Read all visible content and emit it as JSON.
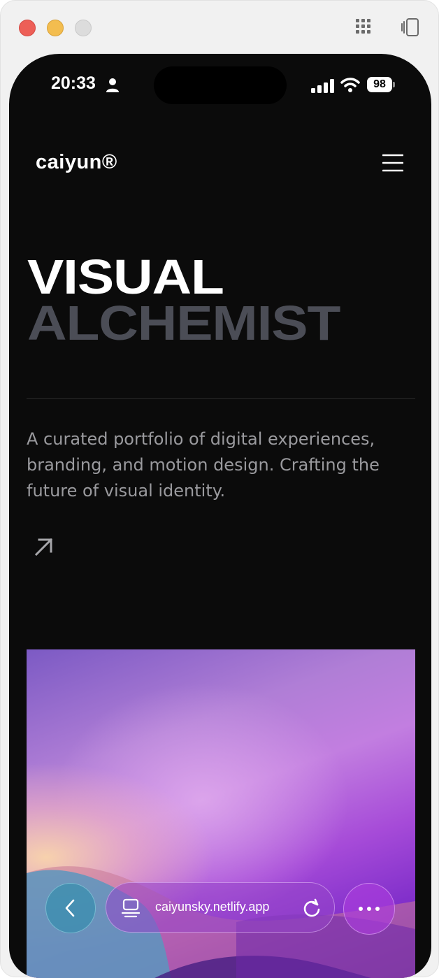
{
  "status_bar": {
    "time": "20:33",
    "battery": "98"
  },
  "site": {
    "logo": "caiyun®",
    "hero_line1": "VISUAL",
    "hero_line2": "ALCHEMIST",
    "description": "A curated portfolio of digital experiences, branding, and motion design. Crafting the future of visual identity."
  },
  "browser": {
    "url": "caiyunsky.netlify.app"
  },
  "icons": {
    "menu": "hamburger-menu-icon",
    "link": "arrow-up-right-icon",
    "back": "chevron-left-icon",
    "reader": "reader-icon",
    "reload": "reload-icon",
    "more": "ellipsis-icon"
  },
  "colors": {
    "background": "#0b0b0b",
    "hero_primary": "#ffffff",
    "hero_secondary": "#4b4d56",
    "description": "#9a9a9e"
  }
}
